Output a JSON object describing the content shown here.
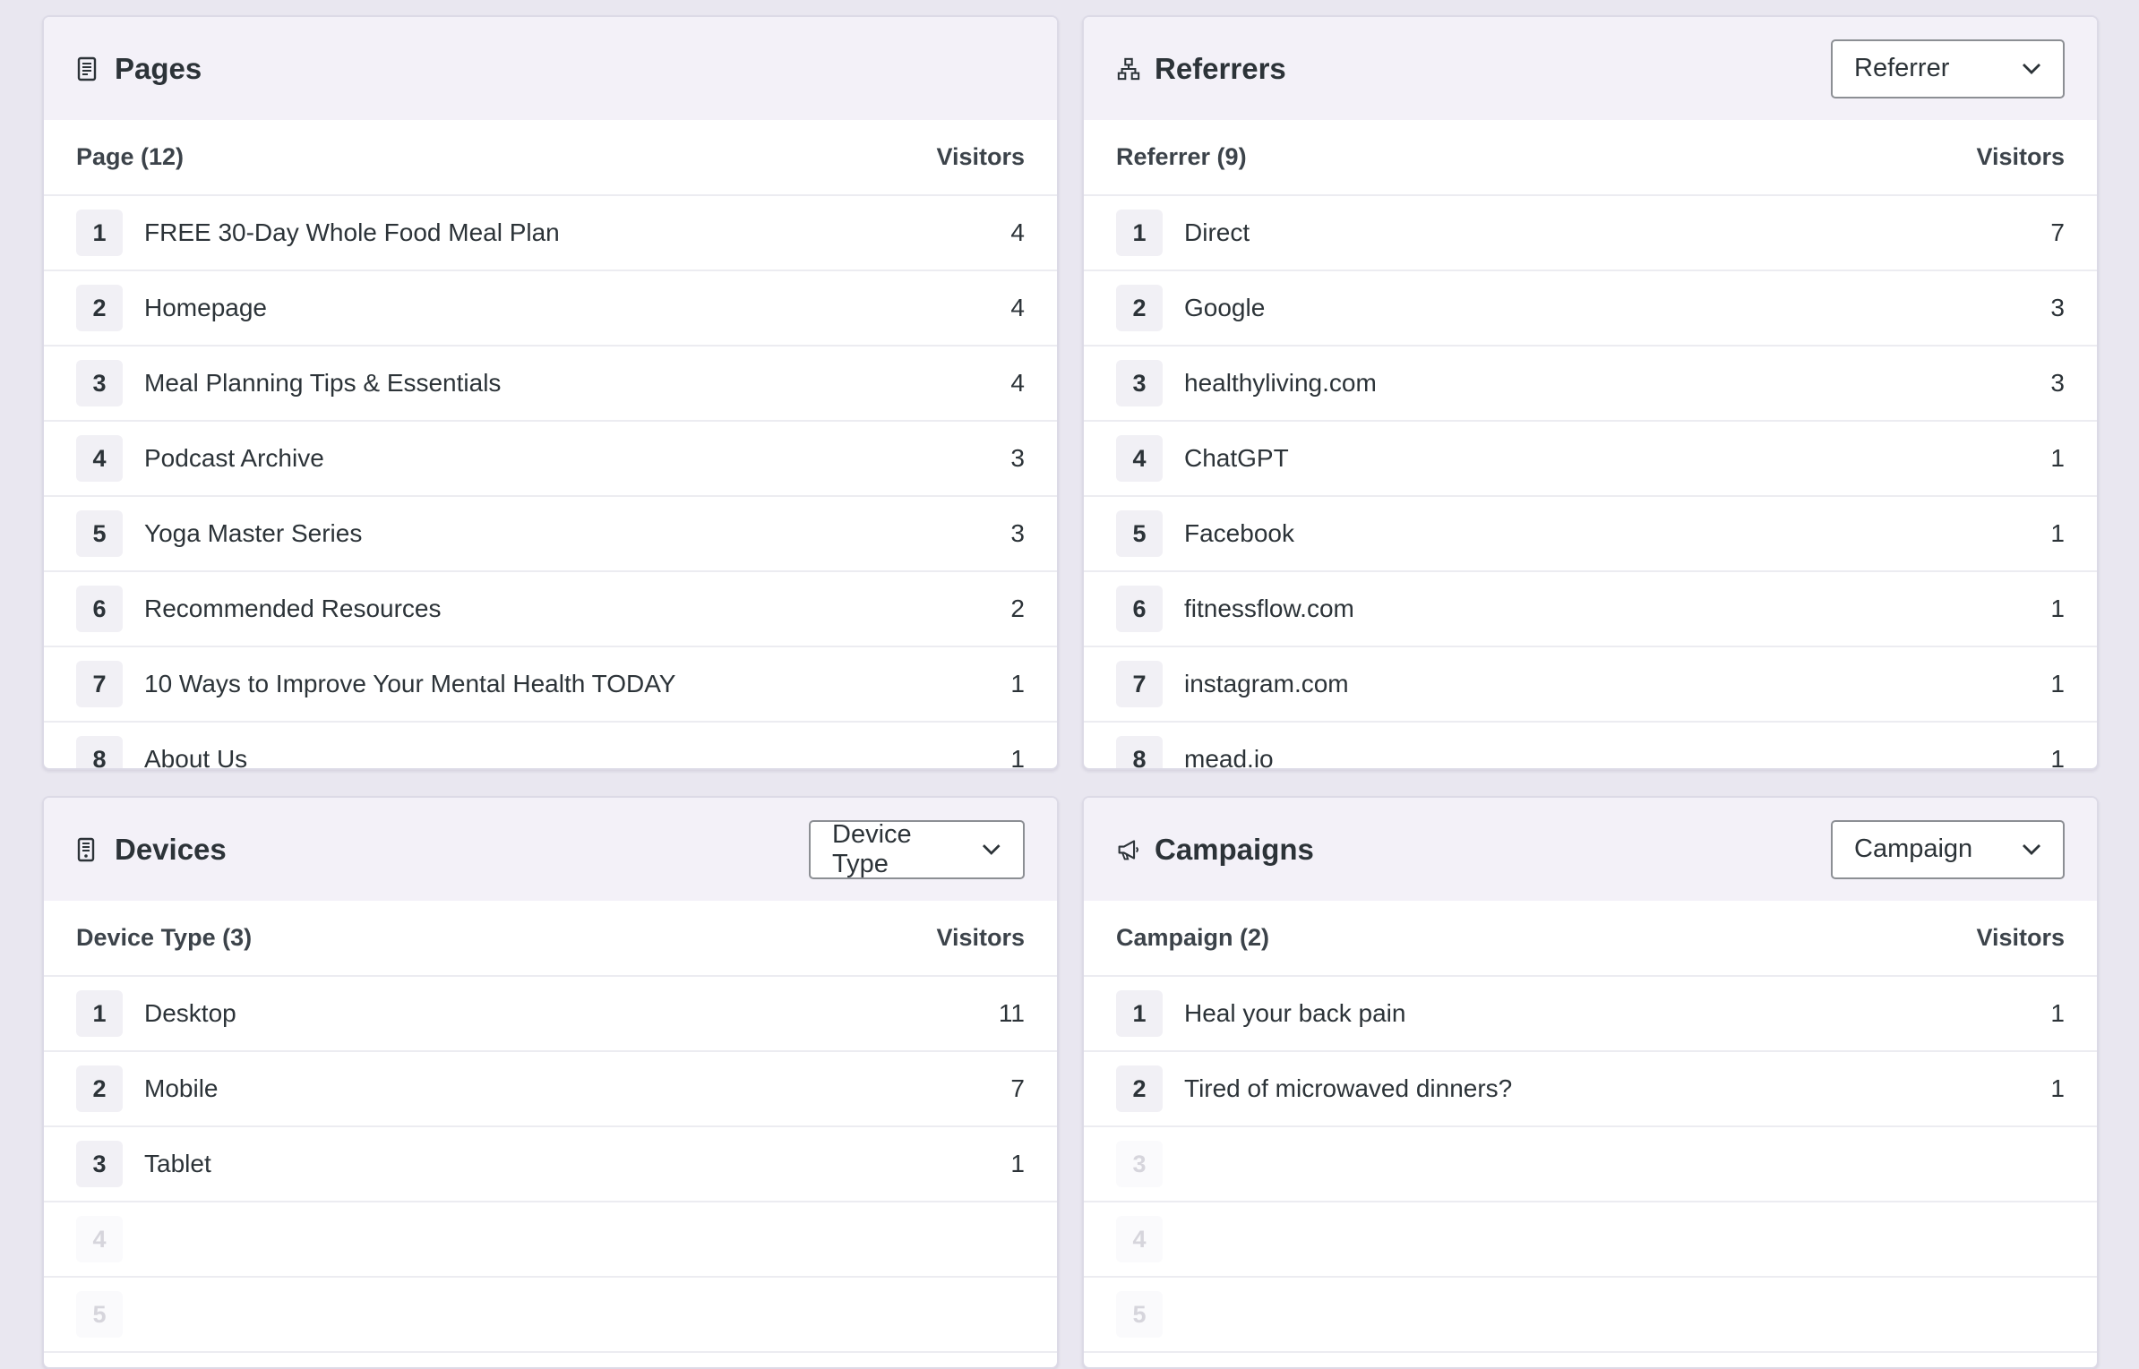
{
  "pages": {
    "title": "Pages",
    "icon": "document-icon",
    "col_label": "Page (12)",
    "col_value": "Visitors",
    "rows": [
      {
        "rank": "1",
        "label": "FREE 30-Day Whole Food Meal Plan",
        "value": "4"
      },
      {
        "rank": "2",
        "label": "Homepage",
        "value": "4"
      },
      {
        "rank": "3",
        "label": "Meal Planning Tips & Essentials",
        "value": "4"
      },
      {
        "rank": "4",
        "label": "Podcast Archive",
        "value": "3"
      },
      {
        "rank": "5",
        "label": "Yoga Master Series",
        "value": "3"
      },
      {
        "rank": "6",
        "label": "Recommended Resources",
        "value": "2"
      },
      {
        "rank": "7",
        "label": "10 Ways to Improve Your Mental Health TODAY",
        "value": "1"
      },
      {
        "rank": "8",
        "label": "About Us",
        "value": "1"
      }
    ]
  },
  "referrers": {
    "title": "Referrers",
    "icon": "sitemap-icon",
    "select_value": "Referrer",
    "col_label": "Referrer (9)",
    "col_value": "Visitors",
    "rows": [
      {
        "rank": "1",
        "label": "Direct",
        "value": "7"
      },
      {
        "rank": "2",
        "label": "Google",
        "value": "3"
      },
      {
        "rank": "3",
        "label": "healthyliving.com",
        "value": "3"
      },
      {
        "rank": "4",
        "label": "ChatGPT",
        "value": "1"
      },
      {
        "rank": "5",
        "label": "Facebook",
        "value": "1"
      },
      {
        "rank": "6",
        "label": "fitnessflow.com",
        "value": "1"
      },
      {
        "rank": "7",
        "label": "instagram.com",
        "value": "1"
      },
      {
        "rank": "8",
        "label": "mead.io",
        "value": "1"
      }
    ]
  },
  "devices": {
    "title": "Devices",
    "icon": "mobile-device-icon",
    "select_value": "Device Type",
    "col_label": "Device Type (3)",
    "col_value": "Visitors",
    "rows": [
      {
        "rank": "1",
        "label": "Desktop",
        "value": "11"
      },
      {
        "rank": "2",
        "label": "Mobile",
        "value": "7"
      },
      {
        "rank": "3",
        "label": "Tablet",
        "value": "1"
      }
    ],
    "empty_ranks": [
      "4",
      "5"
    ]
  },
  "campaigns": {
    "title": "Campaigns",
    "icon": "megaphone-icon",
    "select_value": "Campaign",
    "col_label": "Campaign (2)",
    "col_value": "Visitors",
    "rows": [
      {
        "rank": "1",
        "label": "Heal your back pain",
        "value": "1"
      },
      {
        "rank": "2",
        "label": "Tired of microwaved dinners?",
        "value": "1"
      }
    ],
    "empty_ranks": [
      "3",
      "4",
      "5"
    ]
  }
}
